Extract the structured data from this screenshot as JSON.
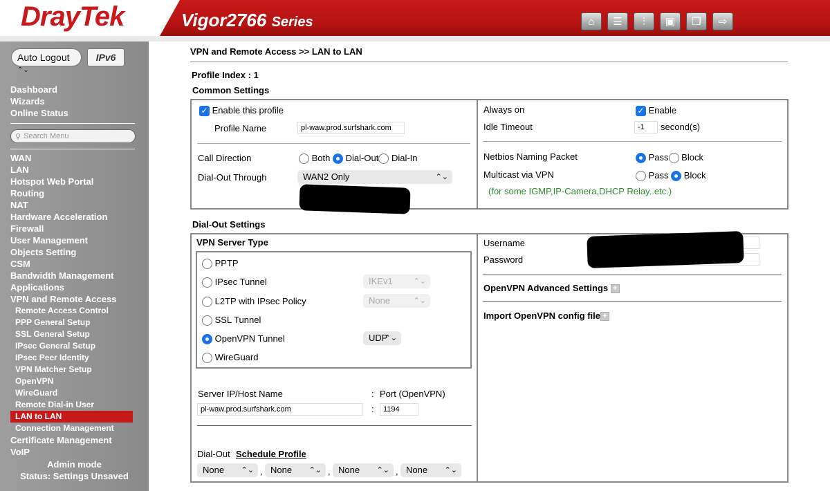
{
  "header": {
    "brand": "DrayTek",
    "model": "Vigor2766",
    "series": "Series",
    "icons": [
      "home-icon",
      "list-icon",
      "sliders-icon",
      "save-icon",
      "book-icon",
      "logout-icon"
    ]
  },
  "sidebar": {
    "auto_logout": "Auto Logout",
    "ipv6": "IPv6",
    "top_items": [
      "Dashboard",
      "Wizards",
      "Online Status"
    ],
    "search_placeholder": "Search Menu",
    "items": [
      "WAN",
      "LAN",
      "Hotspot Web Portal",
      "Routing",
      "NAT",
      "Hardware Acceleration",
      "Firewall",
      "User Management",
      "Objects Setting",
      "CSM",
      "Bandwidth Management",
      "Applications",
      "VPN and Remote Access"
    ],
    "sub_items": [
      "Remote Access Control",
      "PPP General Setup",
      "SSL General Setup",
      "IPsec General Setup",
      "IPsec Peer Identity",
      "VPN Matcher Setup",
      "OpenVPN",
      "WireGuard",
      "Remote Dial-in User",
      "LAN to LAN",
      "Connection Management"
    ],
    "bottom_items": [
      "Certificate Management",
      "VoIP"
    ],
    "admin_mode": "Admin mode",
    "status": "Status: Settings Unsaved"
  },
  "main": {
    "breadcrumb": "VPN and Remote Access >> LAN to LAN",
    "profile_index": "Profile Index : 1",
    "common_settings": "Common Settings",
    "enable_profile": "Enable this profile",
    "profile_name_label": "Profile Name",
    "profile_name_value": "pl-waw.prod.surfshark.com",
    "call_direction_label": "Call Direction",
    "call_direction_options": [
      "Both",
      "Dial-Out",
      "Dial-In"
    ],
    "dial_out_through_label": "Dial-Out Through",
    "dial_out_through_value": "WAN2 Only",
    "always_on_label": "Always on",
    "always_on_enable": "Enable",
    "idle_timeout_label": "Idle Timeout",
    "idle_timeout_value": "-1",
    "idle_timeout_unit": "second(s)",
    "netbios_label": "Netbios Naming Packet",
    "pass": "Pass",
    "block": "Block",
    "multicast_label": "Multicast via VPN",
    "multicast_note": "(for some IGMP,IP-Camera,DHCP Relay..etc.)",
    "dial_out_settings": "Dial-Out Settings",
    "vpn_server_type": "VPN Server Type",
    "types": [
      "PPTP",
      "IPsec Tunnel",
      "L2TP with IPsec Policy",
      "SSL Tunnel",
      "OpenVPN Tunnel",
      "WireGuard"
    ],
    "ipsec_select": "IKEv1",
    "l2tp_select": "None",
    "openvpn_select": "UDP",
    "server_label": "Server IP/Host Name",
    "colon": ":",
    "port_label": "Port (OpenVPN)",
    "server_value": "pl-waw.prod.surfshark.com",
    "port_value": "1194",
    "dial_out_label": "Dial-Out",
    "schedule_profile": "Schedule Profile",
    "schedules": [
      "None",
      "None",
      "None",
      "None"
    ],
    "comma": ",",
    "username_label": "Username",
    "password_label": "Password",
    "openvpn_adv": "OpenVPN Advanced Settings",
    "import_openvpn": "Import OpenVPN config file"
  }
}
